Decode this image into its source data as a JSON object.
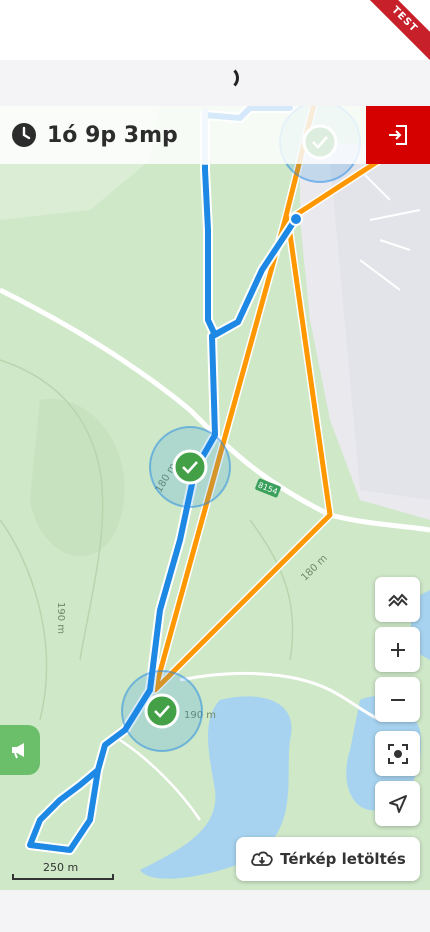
{
  "ribbon": {
    "label": "TEST"
  },
  "timer": {
    "elapsed": "1ó 9p 3mp"
  },
  "map": {
    "elevation_labels": [
      "180 m",
      "180 m",
      "190 m",
      "190 m"
    ],
    "road_number": "8154",
    "scale_label": "250 m",
    "checkpoints_completed": 3
  },
  "download": {
    "label": "Térkép letöltés"
  },
  "colors": {
    "track": "#1e88e5",
    "route": "#ff9800",
    "exit": "#d50000",
    "checkpoint": "#43a047"
  }
}
